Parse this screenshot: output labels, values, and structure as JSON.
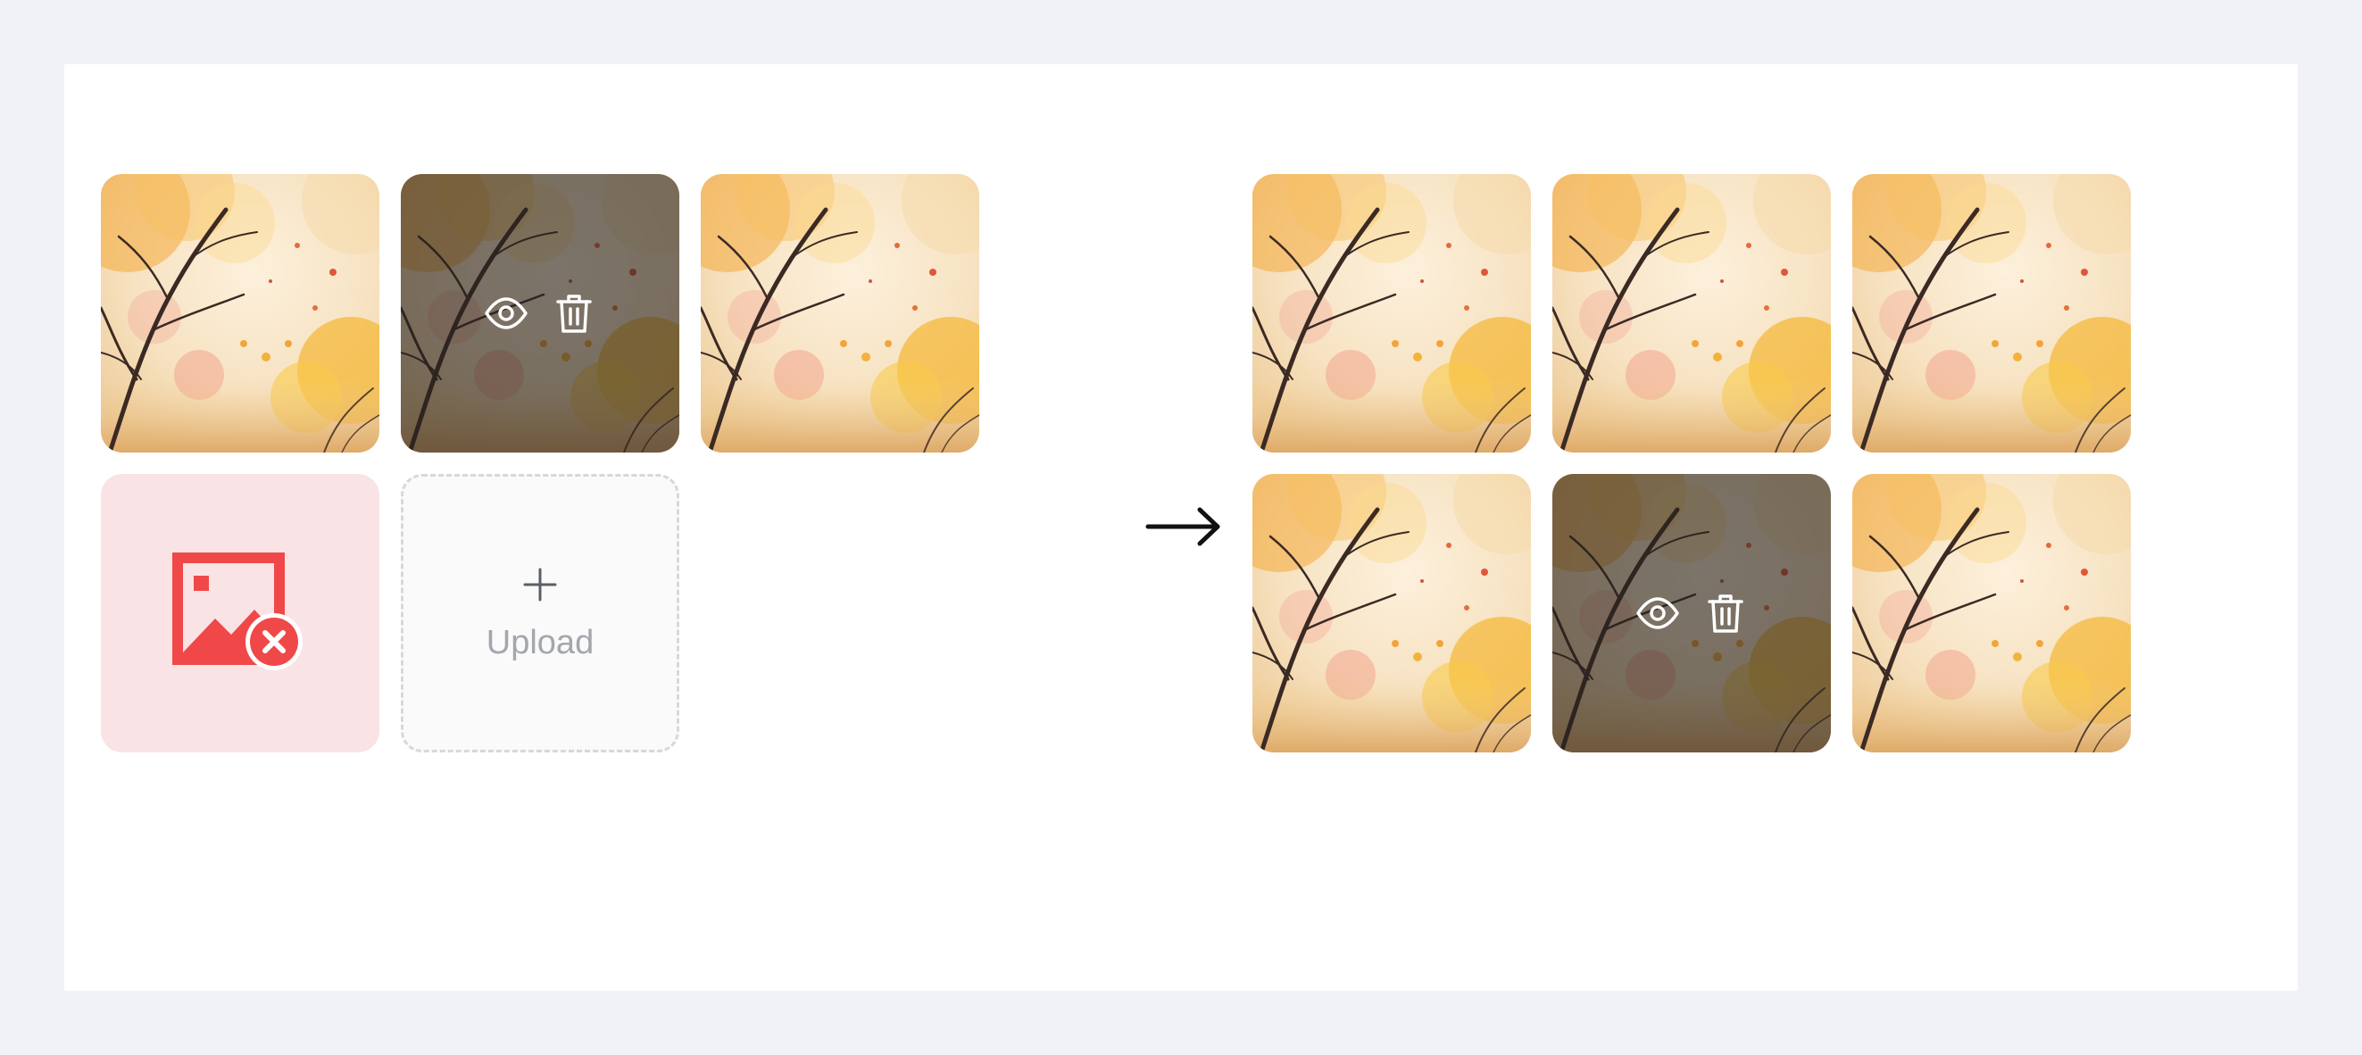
{
  "before": {
    "thumbnails": [
      {
        "state": "default"
      },
      {
        "state": "hover",
        "actions": [
          "eye-icon",
          "trash-icon"
        ]
      },
      {
        "state": "default"
      },
      {
        "state": "error",
        "icon": "image-error-icon"
      },
      {
        "state": "upload",
        "icon": "plus-icon",
        "label": "Upload"
      }
    ]
  },
  "after": {
    "thumbnails": [
      {
        "state": "default"
      },
      {
        "state": "default"
      },
      {
        "state": "default"
      },
      {
        "state": "default"
      },
      {
        "state": "hover",
        "actions": [
          "eye-icon",
          "trash-icon"
        ]
      },
      {
        "state": "default"
      }
    ]
  },
  "transition_icon": "arrow-right-icon",
  "colors": {
    "background": "#f1f2f7",
    "panel": "#ffffff",
    "error_bg": "#f9e3e4",
    "error_icon": "#f04848",
    "upload_bg": "#fafafa",
    "upload_border": "#d8d8d8",
    "upload_text": "#a3a7ad",
    "overlay": "rgba(38,34,30,0.6)"
  }
}
